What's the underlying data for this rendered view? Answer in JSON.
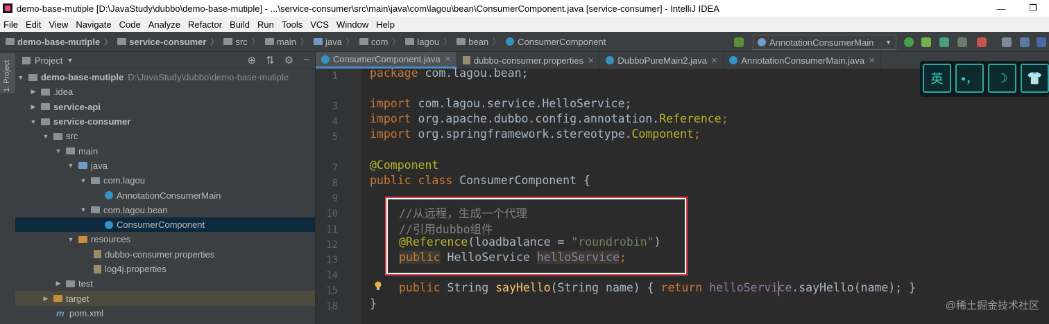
{
  "window": {
    "title": "demo-base-mutiple [D:\\JavaStudy\\dubbo\\demo-base-mutiple] - ...\\service-consumer\\src\\main\\java\\com\\lagou\\bean\\ConsumerComponent.java [service-consumer] - IntelliJ IDEA",
    "minimize": "—",
    "maximize": "❐"
  },
  "menu": [
    "File",
    "Edit",
    "View",
    "Navigate",
    "Code",
    "Analyze",
    "Refactor",
    "Build",
    "Run",
    "Tools",
    "VCS",
    "Window",
    "Help"
  ],
  "breadcrumb": [
    "demo-base-mutiple",
    "service-consumer",
    "src",
    "main",
    "java",
    "com",
    "lagou",
    "bean",
    "ConsumerComponent"
  ],
  "run_config": "AnnotationConsumerMain",
  "left_strip": "1: Project",
  "project_panel": {
    "title": "Project",
    "tree": [
      {
        "label": "demo-base-mutiple",
        "extra": "D:\\JavaStudy\\dubbo\\demo-base-mutiple"
      },
      {
        "label": ".idea"
      },
      {
        "label": "service-api"
      },
      {
        "label": "service-consumer"
      },
      {
        "label": "src"
      },
      {
        "label": "main"
      },
      {
        "label": "java"
      },
      {
        "label": "com.lagou"
      },
      {
        "label": "AnnotationConsumerMain"
      },
      {
        "label": "com.lagou.bean"
      },
      {
        "label": "ConsumerComponent"
      },
      {
        "label": "resources"
      },
      {
        "label": "dubbo-consumer.properties"
      },
      {
        "label": "log4j.properties"
      },
      {
        "label": "test"
      },
      {
        "label": "target"
      },
      {
        "label": "pom.xml"
      }
    ]
  },
  "editor_tabs": [
    "ConsumerComponent.java",
    "dubbo-consumer.properties",
    "DubboPureMain2.java",
    "AnnotationConsumerMain.java"
  ],
  "line_numbers": [
    "1",
    "3",
    "4",
    "5",
    "7",
    "8",
    "9",
    "10",
    "11",
    "12",
    "13",
    "14",
    "15",
    "18"
  ],
  "code": {
    "l0_kw": "package",
    "l0_rest": " com.lagou.bean;",
    "l3_kw": "import",
    "l3_rest": " com.lagou.service.HelloService;",
    "l4_kw": "import",
    "l4_rest": " org.apache.dubbo.config.annotation.",
    "l4_cls": "Reference",
    "l4_end": ";",
    "l5_kw": "import",
    "l5_rest": " org.springframework.stereotype.",
    "l5_cls": "Component",
    "l5_end": ";",
    "l7": "@Component",
    "l8_kw": "public class",
    "l8_rest": " ConsumerComponent {",
    "l10": "//从远程，生成一个代理",
    "l11": "//引用dubbo组件",
    "l12_ann": "@Reference",
    "l12_a": "(loadbalance = ",
    "l12_str": "\"roundrobin\"",
    "l12_b": ")",
    "l13_kw": "public",
    "l13_a": " HelloService ",
    "l13_fld": "helloService",
    "l13_end": ";",
    "l15_kw": "public",
    "l15_a": " String ",
    "l15_m": "sayHello",
    "l15_b": "(String name) { ",
    "l15_kw2": "return",
    "l15_c": " ",
    "l15_fld": "helloService",
    "l15_d": ".sayHello(name); }",
    "l18": "}"
  },
  "ime_toolbar": [
    "英",
    "•，",
    "☽",
    "👕"
  ],
  "watermark": "@稀土掘金技术社区"
}
